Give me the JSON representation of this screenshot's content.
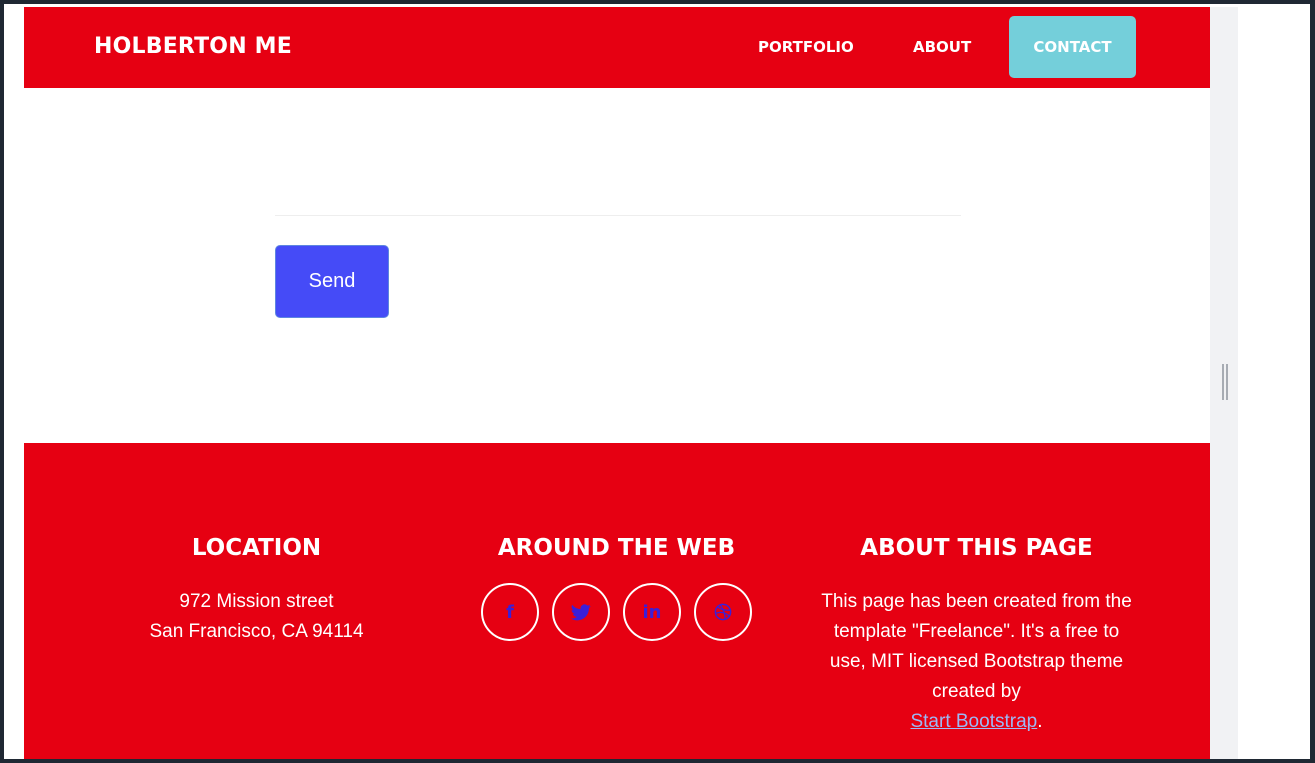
{
  "navbar": {
    "brand": "HOLBERTON ME",
    "links": [
      "PORTFOLIO",
      "ABOUT",
      "CONTACT"
    ],
    "brand_color": "#e60012",
    "active_color": "#74cfda"
  },
  "form": {
    "send_label": "Send",
    "button_color": "#454bf7"
  },
  "footer": {
    "location": {
      "title": "LOCATION",
      "line1": "972 Mission street",
      "line2": "San Francisco, CA 94114"
    },
    "web": {
      "title": "AROUND THE WEB",
      "icons": [
        "facebook-icon",
        "twitter-icon",
        "linkedin-icon",
        "dribbble-icon"
      ],
      "icon_glyphs": [
        "f",
        "",
        "in",
        ""
      ]
    },
    "about": {
      "title": "ABOUT THIS PAGE",
      "text": "This page has been created from the template \"Freelance\". It's a free to use, MIT licensed Bootstrap theme created by",
      "link_text": "Start Bootstrap",
      "trailing": "."
    }
  }
}
